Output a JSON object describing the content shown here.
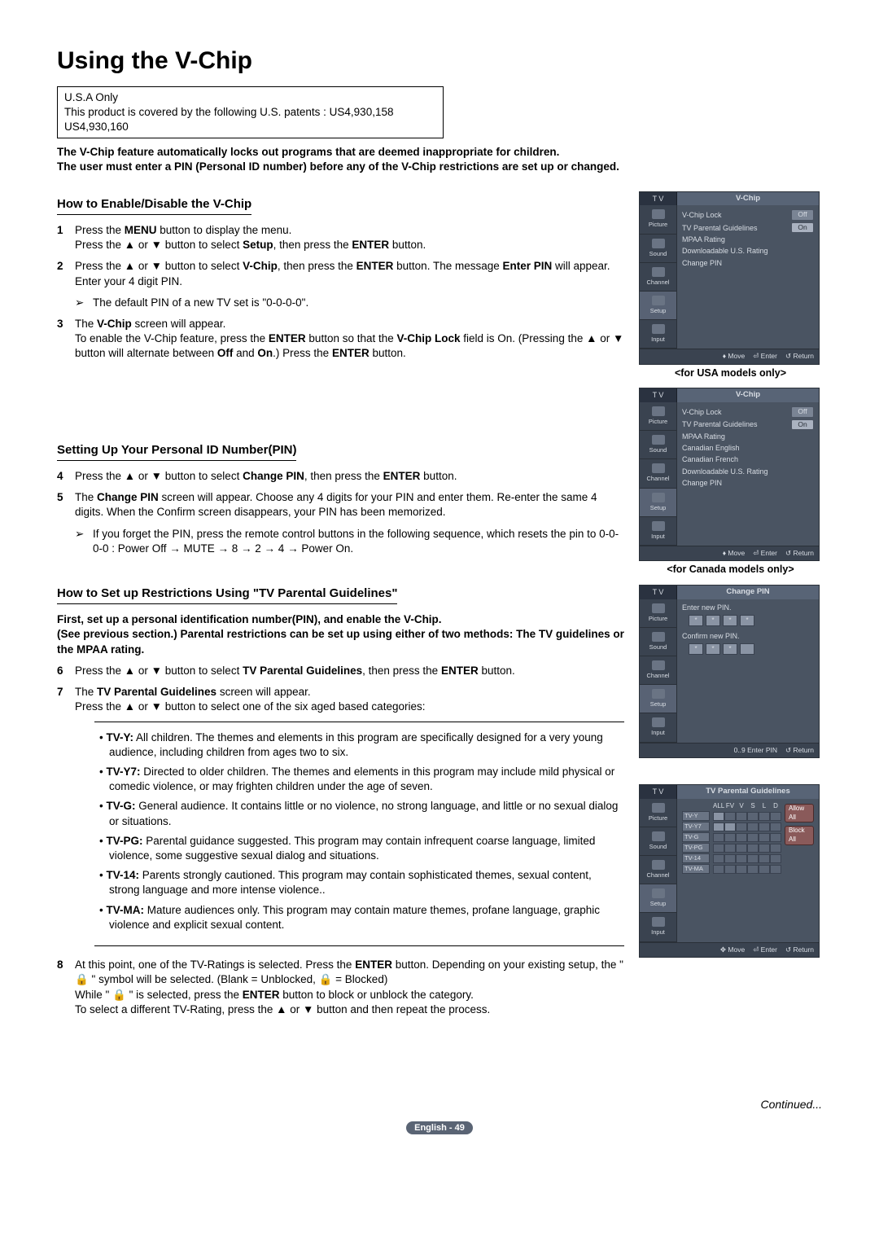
{
  "title": "Using the V-Chip",
  "usa_box_line1": "U.S.A Only",
  "usa_box_line2": "This product is covered by the following U.S. patents : US4,930,158 US4,930,160",
  "intro_line1": "The V-Chip feature automatically locks out programs that are deemed inappropriate for children.",
  "intro_line2": "The user must enter a PIN (Personal ID number) before any of the V-Chip restrictions are set up or changed.",
  "sections": {
    "enable": {
      "heading": "How to Enable/Disable the V-Chip",
      "steps": [
        {
          "n": "1",
          "text_parts": [
            "Press the ",
            "MENU",
            " button to display the menu.\nPress the ▲ or ▼ button to select ",
            "Setup",
            ", then press the ",
            "ENTER",
            " button."
          ]
        },
        {
          "n": "2",
          "text_parts": [
            "Press the ▲ or ▼ button to select ",
            "V-Chip",
            ", then press the ",
            "ENTER",
            " button. The message ",
            "Enter PIN",
            " will appear. Enter your 4 digit PIN."
          ]
        },
        {
          "note": true,
          "text": "The default PIN of a new TV set is \"0-0-0-0\"."
        },
        {
          "n": "3",
          "text_parts": [
            "The ",
            "V-Chip",
            " screen will appear.\nTo enable the V-Chip feature, press the ",
            "ENTER",
            " button so that the ",
            "V-Chip Lock",
            " field is On. (Pressing the ▲ or ▼ button will alternate between ",
            "Off",
            " and ",
            "On",
            ".) Press the ",
            "ENTER",
            " button."
          ]
        }
      ]
    },
    "pin": {
      "heading": "Setting Up Your Personal ID Number(PIN)",
      "steps": [
        {
          "n": "4",
          "text_parts": [
            "Press the ▲ or ▼ button to select ",
            "Change PIN",
            ", then press the ",
            "ENTER",
            " button."
          ]
        },
        {
          "n": "5",
          "text_parts": [
            "The ",
            "Change PIN",
            " screen will appear. Choose any 4 digits for your PIN and enter them. Re-enter the same 4 digits. When the Confirm screen disappears, your PIN has been memorized."
          ]
        },
        {
          "note": true,
          "text": "If you forget the PIN, press the remote control buttons in the following sequence, which resets the pin to 0-0-0-0 : Power Off → MUTE → 8 → 2 → 4 → Power On."
        }
      ]
    },
    "tvpg": {
      "heading": "How to Set up Restrictions Using \"TV Parental Guidelines\"",
      "intro_parts": [
        "First, set up a personal identification number(PIN), and enable the V-Chip.\n(See previous section.)  Parental restrictions can be set up using either of two methods: The TV guidelines or the MPAA rating."
      ],
      "steps": [
        {
          "n": "6",
          "text_parts": [
            "Press the ▲ or ▼ button to select ",
            "TV Parental Guidelines",
            ", then press the ",
            "ENTER",
            " button."
          ]
        },
        {
          "n": "7",
          "text_parts": [
            "The ",
            "TV Parental Guidelines",
            " screen will appear.\nPress the ▲ or ▼ button to select one of the six aged based categories:"
          ]
        }
      ],
      "ratings": [
        {
          "label": "TV-Y:",
          "desc": "All children. The themes and elements in this program are specifically designed for a very young audience, including children from ages two to six."
        },
        {
          "label": "TV-Y7:",
          "desc": "Directed to older children. The themes and elements in this program may include mild physical or comedic violence, or may frighten children under the age of seven."
        },
        {
          "label": "TV-G:",
          "desc": "General audience. It contains little or no violence, no strong language, and little or no sexual dialog or situations."
        },
        {
          "label": "TV-PG:",
          "desc": "Parental guidance suggested. This program may contain infrequent coarse language, limited violence, some suggestive sexual dialog and situations."
        },
        {
          "label": "TV-14:",
          "desc": "Parents strongly cautioned. This program may contain sophisticated themes, sexual content, strong language and more intense violence.."
        },
        {
          "label": "TV-MA:",
          "desc": "Mature audiences only. This program may contain mature themes, profane language, graphic violence and explicit sexual content."
        }
      ],
      "step8_parts": [
        "At this point, one of the TV-Ratings is selected. Press the ",
        "ENTER",
        " button. Depending on your existing setup, the \" 🔒 \" symbol will be selected. (Blank = Unblocked, 🔒 = Blocked)\nWhile \" 🔒 \" is selected, press the ",
        "ENTER",
        " button to block or unblock the category.\nTo select a different TV-Rating, press the ▲ or ▼ button and then repeat the process."
      ]
    }
  },
  "osd": {
    "nav": [
      "Picture",
      "Sound",
      "Channel",
      "Setup",
      "Input"
    ],
    "vchip_title": "V-Chip",
    "tv": "T V",
    "usa_rows": [
      {
        "l": "V-Chip Lock",
        "v": "Off"
      },
      {
        "l": "TV Parental Guidelines",
        "v": "On"
      },
      {
        "l": "MPAA Rating"
      },
      {
        "l": "Downloadable U.S. Rating"
      },
      {
        "l": "Change PIN"
      }
    ],
    "canada_rows": [
      {
        "l": "V-Chip Lock",
        "v": "Off"
      },
      {
        "l": "TV Parental Guidelines",
        "v": "On"
      },
      {
        "l": "MPAA Rating"
      },
      {
        "l": "Canadian English"
      },
      {
        "l": "Canadian French"
      },
      {
        "l": "Downloadable U.S. Rating"
      },
      {
        "l": "Change PIN"
      }
    ],
    "foot_move": "Move",
    "foot_enter": "Enter",
    "foot_return": "Return",
    "foot_enterpin": "Enter PIN",
    "caption_usa": "<for USA models only>",
    "caption_can": "<for Canada models only>",
    "changepin_title": "Change PIN",
    "enter_new": "Enter new PIN.",
    "confirm_new": "Confirm new PIN.",
    "tvpg_title": "TV Parental Guidelines",
    "tvpg_cols": [
      "ALL",
      "FV",
      "V",
      "S",
      "L",
      "D"
    ],
    "tvpg_rows": [
      "TV-Y",
      "TV-Y7",
      "TV-G",
      "TV-PG",
      "TV-14",
      "TV-MA"
    ],
    "allow": "Allow All",
    "block": "Block All"
  },
  "continued": "Continued...",
  "pagenum": "English - 49"
}
